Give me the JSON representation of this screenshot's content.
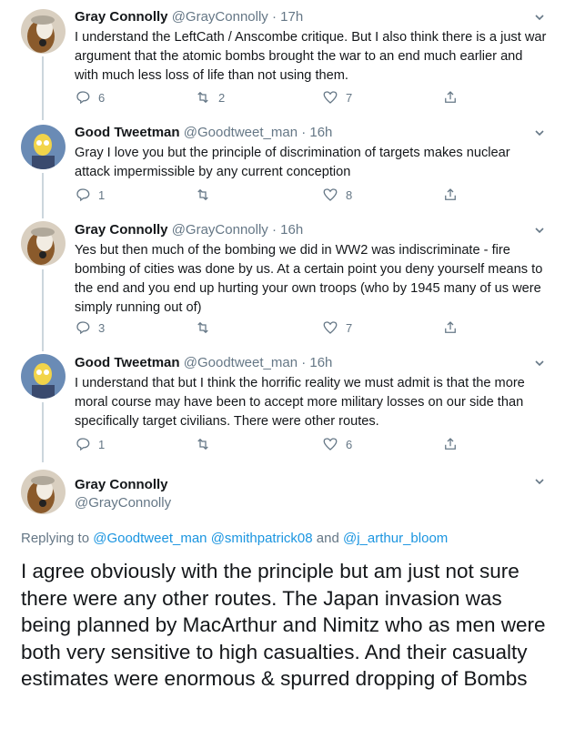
{
  "tweets": [
    {
      "name": "Gray Connolly",
      "handle": "@GrayConnolly",
      "time": "· 17h",
      "avatar": "beagle-avatar",
      "text": "I understand the LeftCath / Anscombe critique.  But I also think there is a just war argument that the atomic bombs brought the war to an end much earlier and with much less loss of life than not using them.",
      "replies": "6",
      "retweets": "2",
      "likes": "7"
    },
    {
      "name": "Good Tweetman",
      "handle": "@Goodtweet_man",
      "time": "· 16h",
      "avatar": "cartoon-avatar",
      "text": "Gray I love you but the principle of discrimination of targets makes nuclear attack impermissible by any current conception",
      "replies": "1",
      "retweets": "",
      "likes": "8"
    },
    {
      "name": "Gray Connolly",
      "handle": "@GrayConnolly",
      "time": "· 16h",
      "avatar": "beagle-avatar",
      "text": "Yes but then much of the bombing we did in WW2 was indiscriminate - fire bombing of cities was done by us. At a certain point you deny yourself means to the end and you end up hurting your own troops (who by 1945 many of us were simply running out of)",
      "replies": "3",
      "retweets": "",
      "likes": "7"
    },
    {
      "name": "Good Tweetman",
      "handle": "@Goodtweet_man",
      "time": "· 16h",
      "avatar": "cartoon-avatar",
      "text": "I understand that but I think the horrific reality we must admit is that the more moral course may have been to accept more military losses on our side than specifically target civilians. There were other routes.",
      "replies": "1",
      "retweets": "",
      "likes": "6"
    }
  ],
  "focus": {
    "name": "Gray Connolly",
    "handle": "@GrayConnolly",
    "replying_prefix": "Replying to ",
    "replying_to": [
      "@Goodtweet_man",
      "@smithpatrick08"
    ],
    "replying_and": " and ",
    "replying_last": "@j_arthur_bloom",
    "text": "I agree obviously with the principle but am just not sure there were any other routes. The Japan invasion was being planned by MacArthur and Nimitz who as men were both very sensitive to high casualties. And their casualty estimates were enormous & spurred dropping of Bombs"
  },
  "colors": {
    "link": "#1b95e0",
    "muted": "#657786",
    "text": "#14171a",
    "line": "#ccd6dd"
  }
}
